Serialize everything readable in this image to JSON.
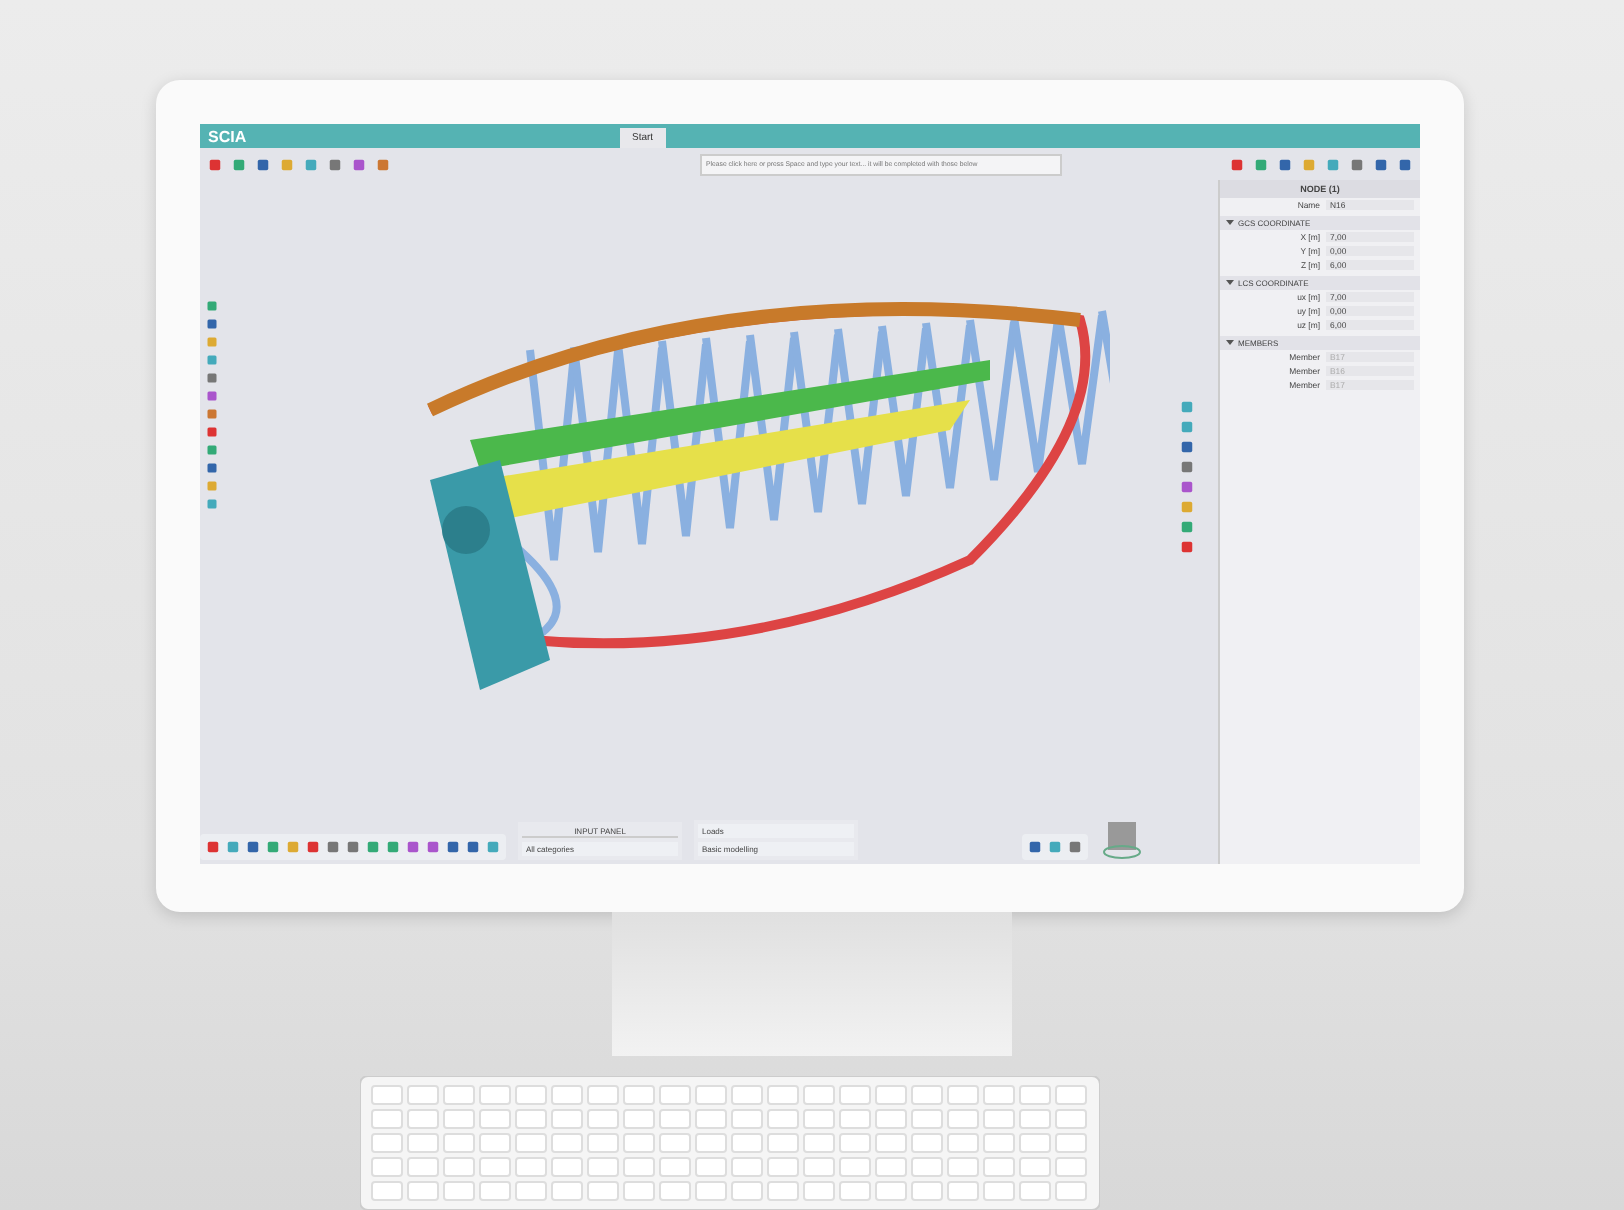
{
  "app": {
    "logo": "SCIA",
    "tab": "Start",
    "search": {
      "placeholder": "Please click here or press Space and type your text... it will be completed with those below"
    }
  },
  "properties": {
    "title": "NODE (1)",
    "name": {
      "label": "Name",
      "value": "N16"
    },
    "sections": [
      {
        "title": "GCS COORDINATE",
        "expanded": true,
        "rows": [
          {
            "label": "X [m]",
            "value": "7,00",
            "disabled": false
          },
          {
            "label": "Y [m]",
            "value": "0,00",
            "disabled": false
          },
          {
            "label": "Z [m]",
            "value": "6,00",
            "disabled": false
          }
        ]
      },
      {
        "title": "LCS COORDINATE",
        "expanded": true,
        "rows": [
          {
            "label": "ux [m]",
            "value": "7,00",
            "disabled": false
          },
          {
            "label": "uy [m]",
            "value": "0,00",
            "disabled": false
          },
          {
            "label": "uz [m]",
            "value": "6,00",
            "disabled": false
          }
        ]
      },
      {
        "title": "MEMBERS",
        "expanded": true,
        "rows": [
          {
            "label": "Member",
            "value": "B17",
            "disabled": true
          },
          {
            "label": "Member",
            "value": "B16",
            "disabled": true
          },
          {
            "label": "Member",
            "value": "B17",
            "disabled": true
          }
        ]
      }
    ]
  },
  "input_panel": {
    "title": "INPUT PANEL",
    "category": "All categories",
    "groups": [
      {
        "label": "Loads"
      },
      {
        "label": "Basic modelling"
      }
    ]
  }
}
